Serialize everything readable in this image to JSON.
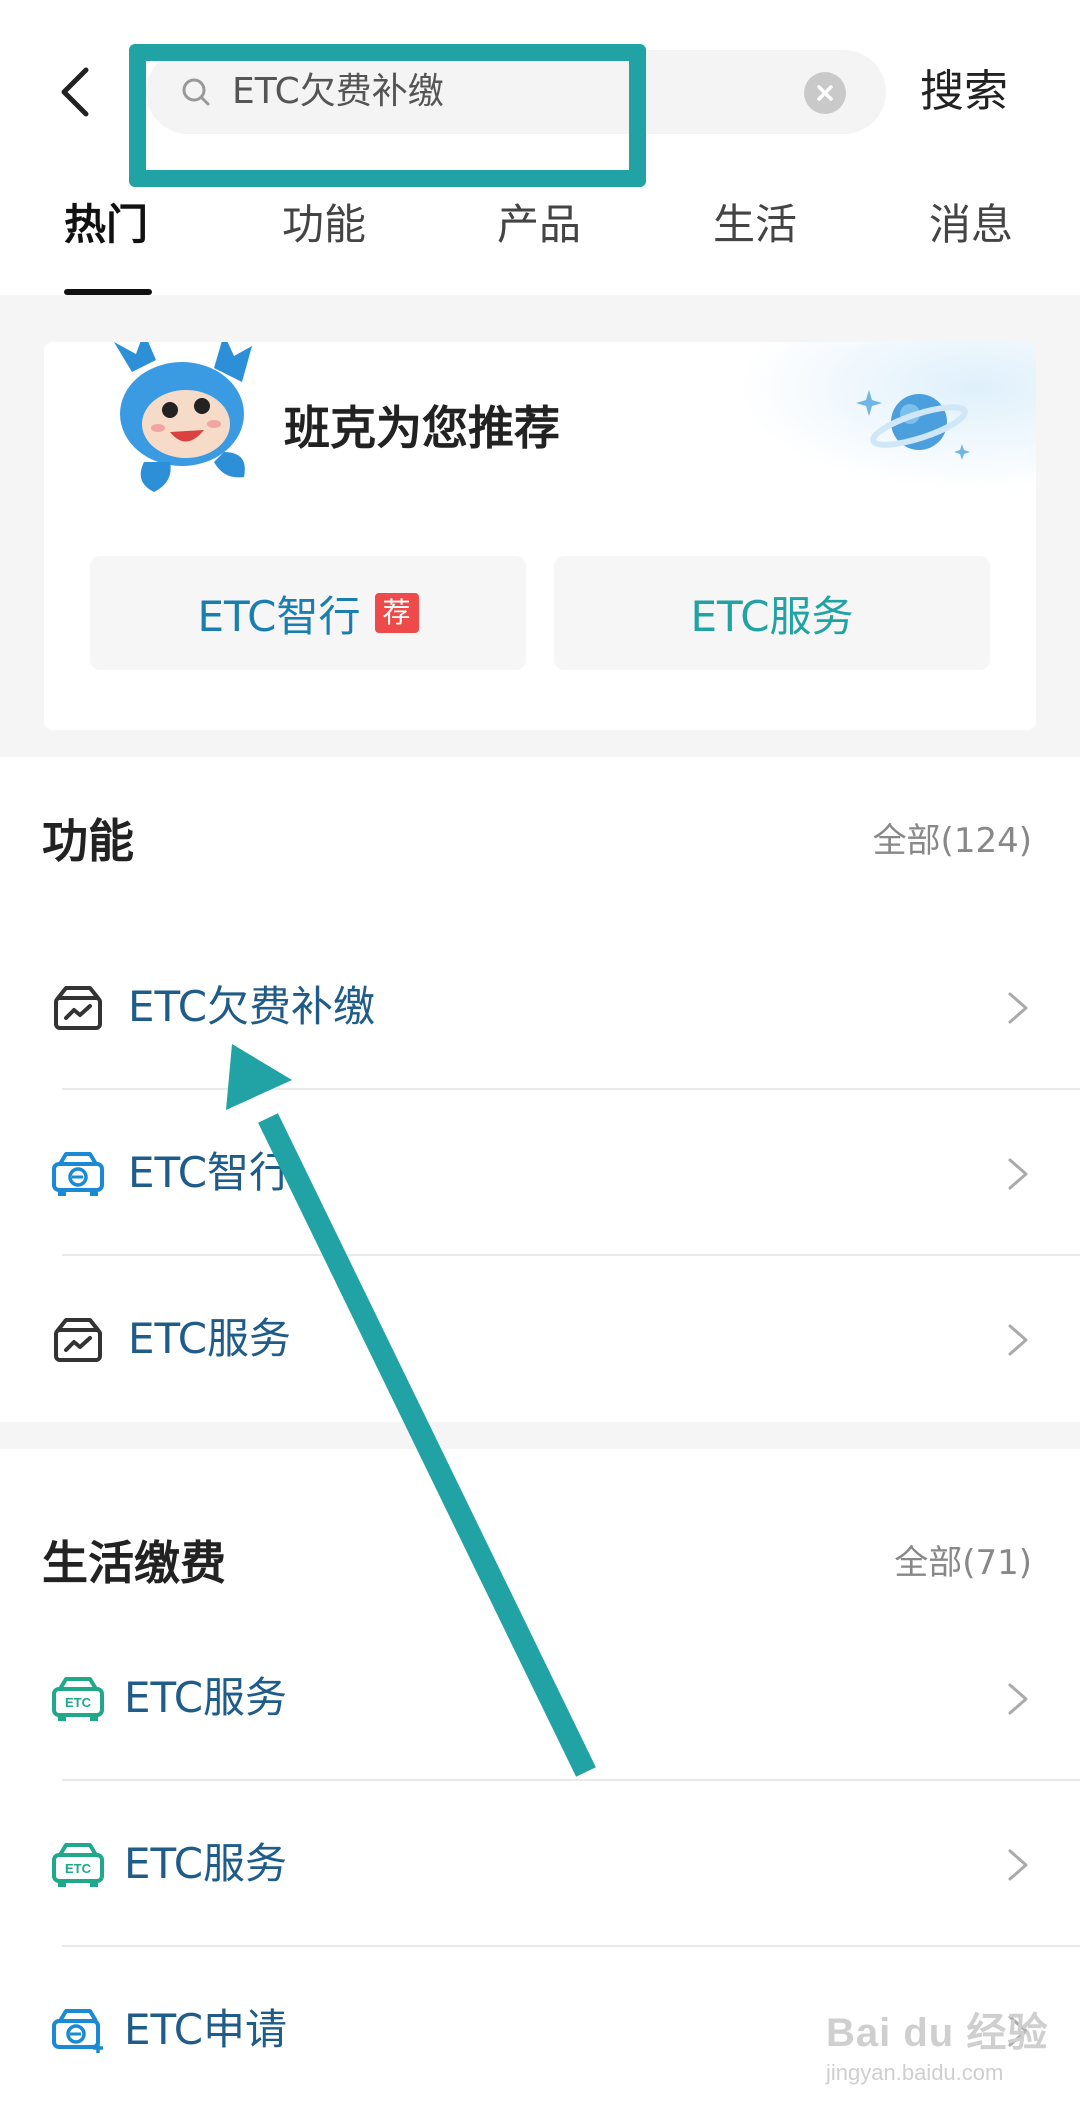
{
  "header": {
    "search_query": "ETC欠费补缴",
    "search_button": "搜索",
    "highlight_color": "#21a3a6"
  },
  "tabs": [
    {
      "label": "热门",
      "active": true
    },
    {
      "label": "功能",
      "active": false
    },
    {
      "label": "产品",
      "active": false
    },
    {
      "label": "生活",
      "active": false
    },
    {
      "label": "消息",
      "active": false
    }
  ],
  "recommend": {
    "title": "班克为您推荐",
    "buttons": [
      {
        "label": "ETC智行",
        "badge": "荐"
      },
      {
        "label": "ETC服务",
        "badge": ""
      }
    ]
  },
  "features": {
    "title": "功能",
    "all_label": "全部(124)",
    "items": [
      {
        "label": "ETC欠费补缴",
        "icon": "card-chart-icon"
      },
      {
        "label": "ETC智行",
        "icon": "etc-car-icon"
      },
      {
        "label": "ETC服务",
        "icon": "card-chart-icon"
      }
    ]
  },
  "life_payment": {
    "title": "生活缴费",
    "all_label": "全部(71)",
    "items": [
      {
        "label": "ETC服务",
        "icon": "etc-green-icon"
      },
      {
        "label": "ETC服务",
        "icon": "etc-green-icon"
      },
      {
        "label": "ETC申请",
        "icon": "etc-apply-icon"
      }
    ]
  },
  "watermark": {
    "main": "Bai du 经验",
    "sub": "jingyan.baidu.com"
  }
}
